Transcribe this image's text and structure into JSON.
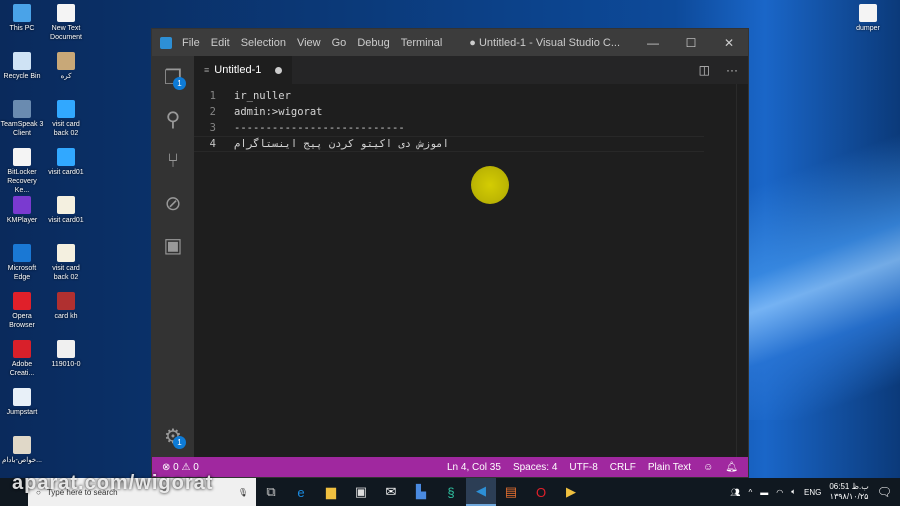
{
  "desktop": {
    "left_icons": [
      {
        "label": "This PC",
        "color": "#4aa3e8"
      },
      {
        "label": "New Text Document",
        "color": "#f4f4f4"
      },
      {
        "label": "Recycle Bin",
        "color": "#cfe3f5"
      },
      {
        "label": "کره",
        "color": "#c8a878"
      },
      {
        "label": "TeamSpeak 3 Client",
        "color": "#6a8bb0"
      },
      {
        "label": "visit card back 02",
        "color": "#31a8ff"
      },
      {
        "label": "BitLocker Recovery Ke...",
        "color": "#f4f4f4"
      },
      {
        "label": "visit card01",
        "color": "#31a8ff"
      },
      {
        "label": "KMPlayer",
        "color": "#7a3ad0"
      },
      {
        "label": "visit card01",
        "color": "#f4f0e0"
      },
      {
        "label": "Microsoft Edge",
        "color": "#1a78d4"
      },
      {
        "label": "visit card back 02",
        "color": "#f4f0e0"
      },
      {
        "label": "Opera Browser",
        "color": "#e0202a"
      },
      {
        "label": "card kh",
        "color": "#b03030"
      },
      {
        "label": "Adobe Creati...",
        "color": "#d8202a"
      },
      {
        "label": "119010-0",
        "color": "#f0f0f0"
      },
      {
        "label": "Jumpstart",
        "color": "#e8f0f8"
      },
      {
        "label": "",
        "color": ""
      },
      {
        "label": "خواص-بادام...",
        "color": "#e0d8c8"
      }
    ],
    "right_icon": {
      "label": "dumper",
      "color": "#f4f4f4"
    }
  },
  "vscode": {
    "menu": [
      "File",
      "Edit",
      "Selection",
      "View",
      "Go",
      "Debug",
      "Terminal"
    ],
    "title": "● Untitled-1 - Visual Studio C...",
    "window_buttons": [
      "—",
      "☐",
      "✕"
    ],
    "tab": {
      "label": "Untitled-1",
      "modified": true
    },
    "activity_badge": "1",
    "settings_badge": "1",
    "lines": [
      {
        "n": "1",
        "text": "ir_nuller"
      },
      {
        "n": "2",
        "text": "admin:>wigorat"
      },
      {
        "n": "3",
        "text": "---------------------------"
      },
      {
        "n": "4",
        "text": "اموزش دی اکیتو کردن پیج اینستاگرام"
      }
    ],
    "status": {
      "errors": "0",
      "warnings": "0",
      "position": "Ln 4, Col 35",
      "spaces": "Spaces: 4",
      "encoding": "UTF-8",
      "eol": "CRLF",
      "language": "Plain Text"
    },
    "accent": "#a0289f"
  },
  "taskbar": {
    "search_placeholder": "Type here to search",
    "lang": "ENG",
    "time": "06:51 ب.ظ",
    "date": "۱۳۹۸/۱۰/۲۵"
  },
  "watermark": "aparat.com/wigorat"
}
